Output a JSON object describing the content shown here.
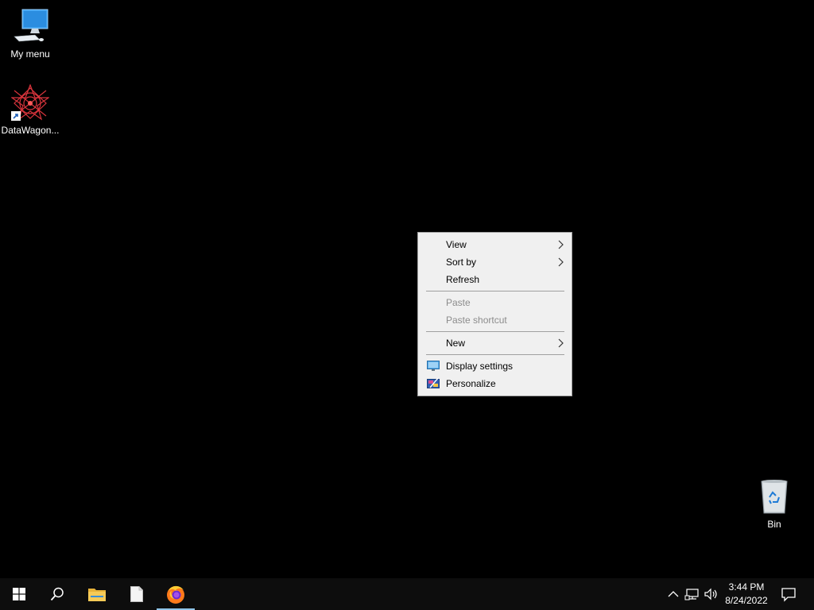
{
  "desktop": {
    "icons": [
      {
        "label": "My menu",
        "icon": "computer-icon"
      },
      {
        "label": "DataWagon...",
        "icon": "datawagon-shortcut-icon"
      },
      {
        "label": "Bin",
        "icon": "recycle-bin-icon"
      }
    ]
  },
  "context_menu": {
    "items": [
      {
        "label": "View",
        "enabled": true,
        "submenu": true
      },
      {
        "label": "Sort by",
        "enabled": true,
        "submenu": true
      },
      {
        "label": "Refresh",
        "enabled": true,
        "submenu": false
      },
      {
        "label": "Paste",
        "enabled": false,
        "submenu": false
      },
      {
        "label": "Paste shortcut",
        "enabled": false,
        "submenu": false
      },
      {
        "label": "New",
        "enabled": true,
        "submenu": true
      },
      {
        "label": "Display settings",
        "enabled": true,
        "submenu": false,
        "icon": "display-settings-icon"
      },
      {
        "label": "Personalize",
        "enabled": true,
        "submenu": false,
        "icon": "personalize-icon"
      }
    ]
  },
  "taskbar": {
    "buttons": [
      {
        "name": "start",
        "icon": "windows-logo-icon"
      },
      {
        "name": "search",
        "icon": "search-icon"
      },
      {
        "name": "file-explorer",
        "icon": "folder-icon"
      },
      {
        "name": "notepad",
        "icon": "document-icon"
      },
      {
        "name": "firefox",
        "icon": "firefox-icon",
        "active": true
      }
    ],
    "tray": {
      "icons": [
        "chevron-up-icon",
        "network-icon",
        "volume-icon",
        "notifications-icon"
      ],
      "time": "3:44 PM",
      "date": "8/24/2022"
    }
  },
  "colors": {
    "desktop_bg": "#000000",
    "menu_bg": "#f0f0f0",
    "menu_disabled_text": "#8c8c8c",
    "taskbar_bg": "#0d0d0d",
    "active_indicator": "#8fc4e8"
  }
}
